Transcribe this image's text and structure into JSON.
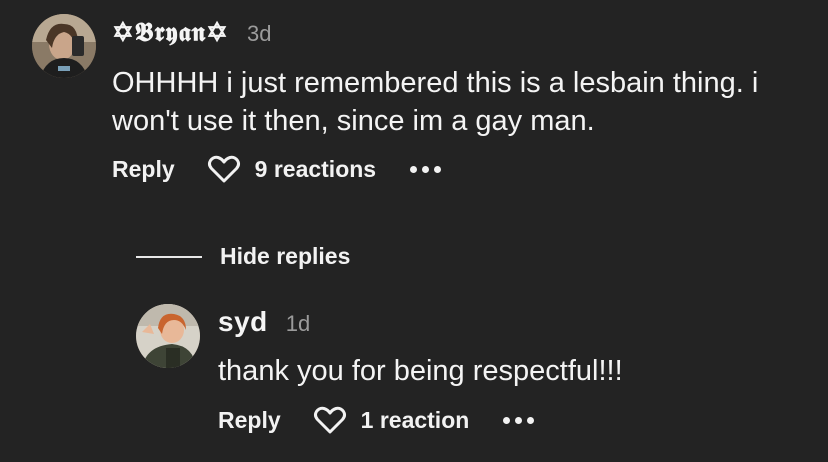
{
  "comments": [
    {
      "username": "✡𝕭𝖗𝖞𝖆𝖓✡",
      "time": "3d",
      "text": "OHHHH i just remembered this is a lesbain thing. i won't use it then, since im a gay man.",
      "reply_label": "Reply",
      "reactions_label": "9 reactions"
    }
  ],
  "hide_replies_label": "Hide replies",
  "replies": [
    {
      "username": "syd",
      "time": "1d",
      "text": "thank you for being respectful!!!",
      "reply_label": "Reply",
      "reactions_label": "1 reaction"
    }
  ],
  "icons": {
    "heart": "heart-icon",
    "more": "more-options-icon"
  },
  "colors": {
    "background": "#232323",
    "text": "#f4f4f4",
    "muted": "#9b9b9b"
  }
}
